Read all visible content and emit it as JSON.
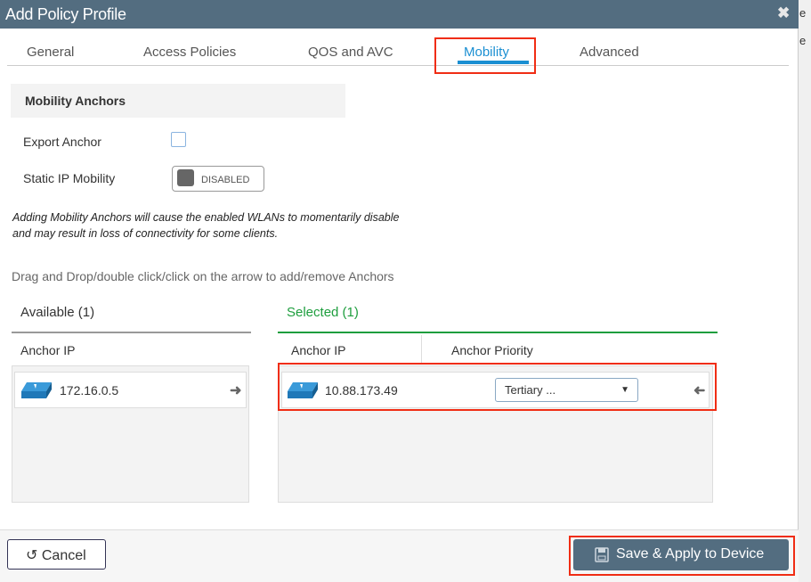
{
  "background": {
    "fragments": [
      "e",
      "e"
    ]
  },
  "dialog": {
    "title": "Add Policy Profile",
    "close_icon": "close-icon"
  },
  "tabs": [
    {
      "label": "General"
    },
    {
      "label": "Access Policies"
    },
    {
      "label": "QOS and AVC"
    },
    {
      "label": "Mobility",
      "active": true
    },
    {
      "label": "Advanced"
    }
  ],
  "section": {
    "title": "Mobility Anchors"
  },
  "form": {
    "export_anchor_label": "Export Anchor",
    "export_anchor_checked": false,
    "static_ip_label": "Static IP Mobility",
    "static_ip_state": "DISABLED"
  },
  "warning": "Adding Mobility Anchors will cause the enabled WLANs to momentarily disable and may result in loss of connectivity for some clients.",
  "hint": "Drag and Drop/double click/click on the arrow to add/remove Anchors",
  "available": {
    "title": "Available (1)",
    "col": "Anchor IP",
    "items": [
      {
        "ip": "172.16.0.5"
      }
    ]
  },
  "selected": {
    "title": "Selected (1)",
    "col_ip": "Anchor IP",
    "col_priority": "Anchor Priority",
    "items": [
      {
        "ip": "10.88.173.49",
        "priority": "Tertiary ..."
      }
    ]
  },
  "footer": {
    "cancel": "Cancel",
    "save": "Save & Apply to Device"
  },
  "colors": {
    "titlebar": "#536d80",
    "accent": "#1b8fd2",
    "selected_green": "#1e9e3e",
    "highlight": "#f02d14"
  }
}
